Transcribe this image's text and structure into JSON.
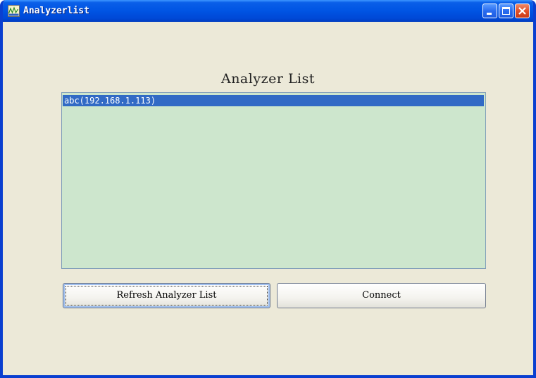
{
  "window": {
    "title": "Analyzerlist",
    "controls": {
      "minimize": "minimize-icon",
      "maximize": "maximize-icon",
      "close": "close-icon"
    }
  },
  "main": {
    "heading": "Analyzer List",
    "analyzers": [
      {
        "label": "abc(192.168.1.113)",
        "selected": true
      }
    ],
    "refresh_button_label": "Refresh Analyzer List",
    "connect_button_label": "Connect"
  },
  "colors": {
    "titlebar": "#0054e3",
    "window_bg": "#ece9d8",
    "list_bg": "#cde6cd",
    "selection": "#316ac5"
  }
}
